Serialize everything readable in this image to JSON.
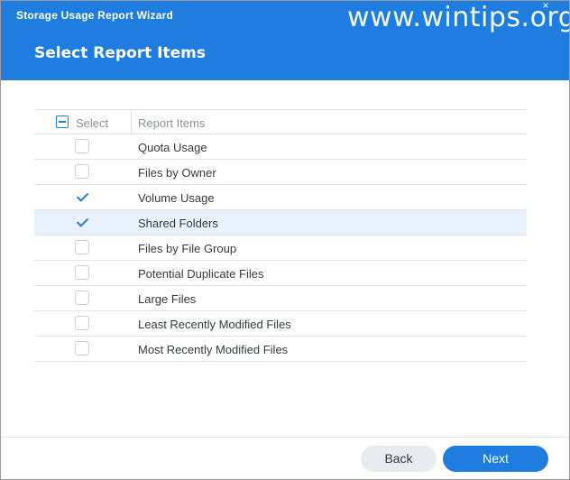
{
  "window": {
    "title": "Storage Usage Report Wizard",
    "page_title": "Select Report Items",
    "watermark": "www.wintips.org",
    "close_glyph": "×"
  },
  "table": {
    "select_header": "Select",
    "items_header": "Report Items",
    "select_all_state": "indeterminate",
    "rows": [
      {
        "label": "Quota Usage",
        "checked": false,
        "highlighted": false
      },
      {
        "label": "Files by Owner",
        "checked": false,
        "highlighted": false
      },
      {
        "label": "Volume Usage",
        "checked": true,
        "highlighted": false
      },
      {
        "label": "Shared Folders",
        "checked": true,
        "highlighted": true
      },
      {
        "label": "Files by File Group",
        "checked": false,
        "highlighted": false
      },
      {
        "label": "Potential Duplicate Files",
        "checked": false,
        "highlighted": false
      },
      {
        "label": "Large Files",
        "checked": false,
        "highlighted": false
      },
      {
        "label": "Least Recently Modified Files",
        "checked": false,
        "highlighted": false
      },
      {
        "label": "Most Recently Modified Files",
        "checked": false,
        "highlighted": false
      }
    ]
  },
  "footer": {
    "back_label": "Back",
    "next_label": "Next"
  },
  "colors": {
    "accent": "#1f7de0",
    "row_highlight": "#e9f2fc"
  }
}
